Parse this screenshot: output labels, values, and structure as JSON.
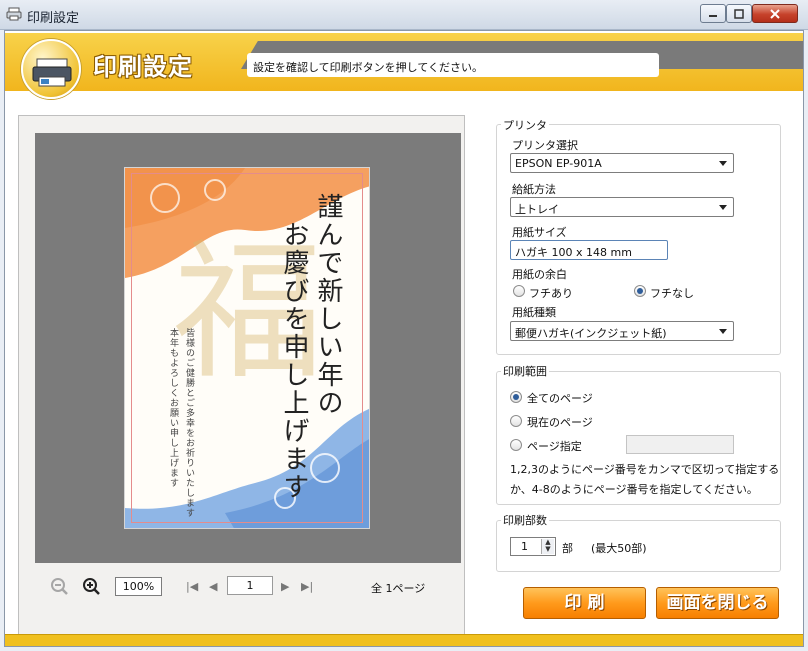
{
  "window": {
    "title": "印刷設定"
  },
  "header": {
    "title": "印刷設定",
    "message": "設定を確認して印刷ボタンを押してください。"
  },
  "preview": {
    "greeting_line1": "謹んで新しい年の",
    "greeting_line2": "お慶びを申し上げます",
    "sub_line1": "皆様のご健勝とご多幸をお祈りいたします",
    "sub_line2": "本年もよろしくお願い申し上げます",
    "fuku": "福",
    "zoom": "100%",
    "page": "1",
    "total_pages": "全 1ページ"
  },
  "printer_group": {
    "legend": "プリンタ",
    "printer_select_label": "プリンタ選択",
    "printer_select_value": "EPSON EP-901A",
    "paper_feed_label": "給紙方法",
    "paper_feed_value": "上トレイ",
    "paper_size_label": "用紙サイズ",
    "paper_size_value": "ハガキ 100 x 148 mm",
    "margin_label": "用紙の余白",
    "margin_with": "フチあり",
    "margin_without": "フチなし",
    "margin_selected": "フチなし",
    "paper_type_label": "用紙種類",
    "paper_type_value": "郵便ハガキ(インクジェット紙)"
  },
  "range_group": {
    "legend": "印刷範囲",
    "all_pages": "全てのページ",
    "current_page": "現在のページ",
    "page_spec": "ページ指定",
    "page_spec_value": "",
    "note_line1": "1,2,3のようにページ番号をカンマで区切って指定する",
    "note_line2": "か、4-8のようにページ番号を指定してください。",
    "selected": "全てのページ"
  },
  "copies_group": {
    "legend": "印刷部数",
    "value": "1",
    "unit": "部",
    "max": "(最大50部)"
  },
  "actions": {
    "print": "印 刷",
    "close": "画面を閉じる"
  },
  "colors": {
    "accent": "#f1b51d",
    "button": "#ff9a1c",
    "preview_bg": "#7b7b7b"
  }
}
